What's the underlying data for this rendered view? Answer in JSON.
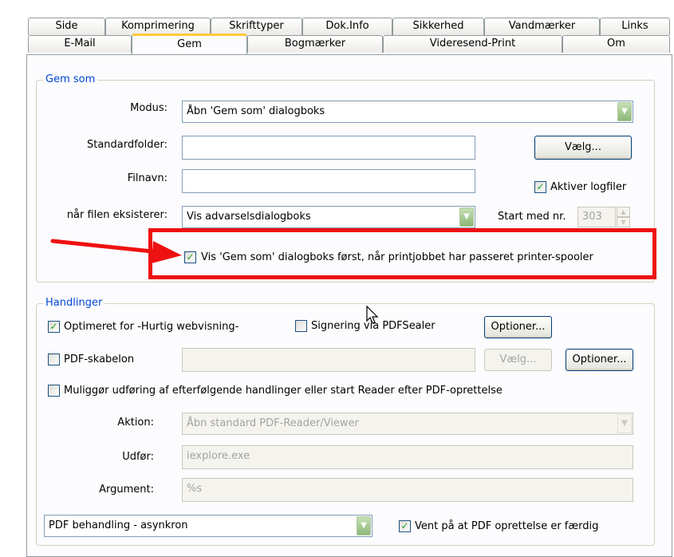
{
  "tabs_row1": [
    "Side",
    "Komprimering",
    "Skrifttyper",
    "Dok.Info",
    "Sikkerhed",
    "Vandmærker",
    "Links"
  ],
  "tabs_row2": [
    "E-Mail",
    "Gem",
    "Bogmærker",
    "Videresend-Print",
    "Om"
  ],
  "active_tab": "Gem",
  "gem_som": {
    "legend": "Gem som",
    "modus_label": "Modus:",
    "modus_value": "Åbn 'Gem som' dialogboks",
    "standardfolder_label": "Standardfolder:",
    "standardfolder_value": "",
    "vaelg_label": "Vælg...",
    "filnavn_label": "Filnavn:",
    "filnavn_value": "",
    "aktiver_logfiler_label": "Aktiver logfiler",
    "aktiver_logfiler_checked": true,
    "eksisterer_label": "når filen eksisterer:",
    "eksisterer_value": "Vis advarselsdialogboks",
    "start_med_nr_label": "Start med nr.",
    "start_med_nr_value": "303",
    "vis_gem_som_label": "Vis 'Gem som' dialogboks først, når printjobbet har passeret printer-spooler",
    "vis_gem_som_checked": true
  },
  "handlinger": {
    "legend": "Handlinger",
    "optimeret_label": "Optimeret for -Hurtig webvisning-",
    "optimeret_checked": true,
    "signering_label": "Signering via PDFSealer",
    "signering_checked": false,
    "optioner1_label": "Optioner...",
    "pdf_skabelon_label": "PDF-skabelon",
    "pdf_skabelon_checked": false,
    "pdf_skabelon_value": "",
    "vaelg2_label": "Vælg...",
    "optioner2_label": "Optioner...",
    "muliggoer_label": "Muliggør udføring af efterfølgende handlinger eller start Reader efter PDF-oprettelse",
    "muliggoer_checked": false,
    "aktion_label": "Aktion:",
    "aktion_value": "Åbn standard PDF-Reader/Viewer",
    "udfoer_label": "Udfør:",
    "udfoer_value": "iexplore.exe",
    "argument_label": "Argument:",
    "argument_value": "%s",
    "pdf_behandling_value": "PDF behandling - asynkron",
    "vent_label": "Vent på at PDF oprettelse er færdig",
    "vent_checked": true
  },
  "icons": {
    "dropdown": "chevron-down-icon",
    "checkmark": "checkmark-icon",
    "arrow": "red-arrow-annotation",
    "cursor": "mouse-cursor-icon"
  },
  "colors": {
    "legend_text": "#0046d5",
    "annotation_red": "#ee1111",
    "active_tab_accent": "#ffc83c",
    "check_green": "#21a121"
  }
}
